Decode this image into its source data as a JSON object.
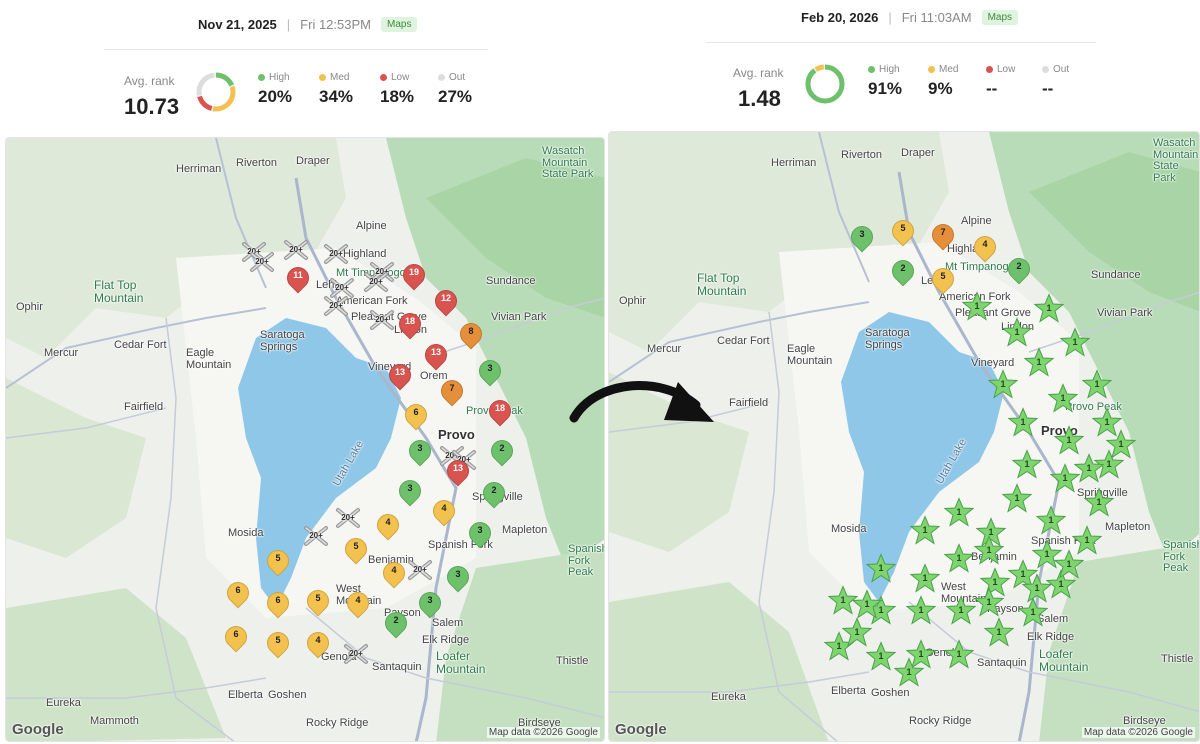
{
  "before": {
    "date": "Nov 21, 2025",
    "time": "Fri 12:53PM",
    "tag": "Maps",
    "avg_label": "Avg. rank",
    "avg_value": "10.73",
    "stats": [
      {
        "label": "High",
        "value": "20%",
        "color": "#6cc16a",
        "fraction": 0.2
      },
      {
        "label": "Med",
        "value": "34%",
        "color": "#f2c14e",
        "fraction": 0.34
      },
      {
        "label": "Low",
        "value": "18%",
        "color": "#d9534f",
        "fraction": 0.18
      },
      {
        "label": "Out",
        "value": "27%",
        "color": "#dddddd",
        "fraction": 0.27
      }
    ],
    "map_labels": {
      "riverton": "Riverton",
      "draper": "Draper",
      "herriman": "Herriman",
      "wasatch": "Wasatch Mountain State Park",
      "alpine": "Alpine",
      "highland": "Highland",
      "lehi": "Lehi",
      "mt_timp": "Mt Timpanogos",
      "sundance": "Sundance",
      "flat_top": "Flat Top Mountain",
      "ophir": "Ophir",
      "american_fork": "American Fork",
      "pleasant_grove": "Pleasant Grove",
      "lindon": "Lindon",
      "vivian_park": "Vivian Park",
      "saratoga": "Saratoga Springs",
      "cedar_fort": "Cedar Fort",
      "mercur": "Mercur",
      "eagle_mountain": "Eagle Mountain",
      "vineyard": "Vineyard",
      "orem": "Orem",
      "provo_peak": "Provo Peak",
      "fairfield": "Fairfield",
      "utah_lake": "Utah Lake",
      "provo": "Provo",
      "springville": "Springville",
      "mosida": "Mosida",
      "mapleton": "Mapleton",
      "spanish_fork": "Spanish Fork",
      "spanish_fork_peak": "Spanish Fork Peak",
      "benjamin": "Benjamin",
      "west_mountain": "West Mountain",
      "payson": "Payson",
      "salem": "Salem",
      "elk_ridge": "Elk Ridge",
      "genola": "Genola",
      "santaquin": "Santaquin",
      "loafer": "Loafer Mountain",
      "eureka": "Eureka",
      "elberta": "Elberta",
      "goshen": "Goshen",
      "mammoth": "Mammoth",
      "rocky_ridge": "Rocky Ridge",
      "birdseye": "Birdseye",
      "thistle": "Thistle"
    },
    "google": "Google",
    "attribution": "Map data ©2026 Google",
    "pins": [
      {
        "v": "11",
        "c": "red"
      },
      {
        "v": "19",
        "c": "red"
      },
      {
        "v": "12",
        "c": "red"
      },
      {
        "v": "18",
        "c": "red"
      },
      {
        "v": "8",
        "c": "orange"
      },
      {
        "v": "13",
        "c": "red"
      },
      {
        "v": "13",
        "c": "red"
      },
      {
        "v": "3",
        "c": "green"
      },
      {
        "v": "7",
        "c": "orange"
      },
      {
        "v": "6",
        "c": "yellow"
      },
      {
        "v": "18",
        "c": "red"
      },
      {
        "v": "3",
        "c": "green"
      },
      {
        "v": "2",
        "c": "green"
      },
      {
        "v": "13",
        "c": "red"
      },
      {
        "v": "3",
        "c": "green"
      },
      {
        "v": "2",
        "c": "green"
      },
      {
        "v": "4",
        "c": "yellow"
      },
      {
        "v": "4",
        "c": "yellow"
      },
      {
        "v": "3",
        "c": "green"
      },
      {
        "v": "5",
        "c": "yellow"
      },
      {
        "v": "5",
        "c": "yellow"
      },
      {
        "v": "4",
        "c": "yellow"
      },
      {
        "v": "3",
        "c": "green"
      },
      {
        "v": "6",
        "c": "yellow"
      },
      {
        "v": "6",
        "c": "yellow"
      },
      {
        "v": "5",
        "c": "yellow"
      },
      {
        "v": "4",
        "c": "yellow"
      },
      {
        "v": "3",
        "c": "green"
      },
      {
        "v": "2",
        "c": "green"
      },
      {
        "v": "6",
        "c": "yellow"
      },
      {
        "v": "5",
        "c": "yellow"
      },
      {
        "v": "4",
        "c": "yellow"
      }
    ],
    "grid_markers": [
      "20+",
      "20+",
      "20+",
      "20+",
      "20+",
      "20+",
      "20+",
      "20+",
      "20+",
      "20+",
      "20+",
      "20+",
      "20+",
      "20+",
      "20+"
    ]
  },
  "after": {
    "date": "Feb 20, 2026",
    "time": "Fri 11:03AM",
    "tag": "Maps",
    "avg_label": "Avg. rank",
    "avg_value": "1.48",
    "stats": [
      {
        "label": "High",
        "value": "91%",
        "color": "#6cc16a",
        "fraction": 0.91
      },
      {
        "label": "Med",
        "value": "9%",
        "color": "#f2c14e",
        "fraction": 0.09
      },
      {
        "label": "Low",
        "value": "--",
        "color": "#d9534f",
        "fraction": 0
      },
      {
        "label": "Out",
        "value": "--",
        "color": "#dddddd",
        "fraction": 0
      }
    ],
    "google": "Google",
    "attribution": "Map data ©2026 Google",
    "pins": [
      {
        "v": "3",
        "c": "green"
      },
      {
        "v": "5",
        "c": "yellow"
      },
      {
        "v": "7",
        "c": "orange"
      },
      {
        "v": "4",
        "c": "yellow"
      },
      {
        "v": "2",
        "c": "green"
      },
      {
        "v": "5",
        "c": "yellow"
      },
      {
        "v": "2",
        "c": "green"
      }
    ],
    "stars": [
      "1",
      "1",
      "1",
      "1",
      "1",
      "1",
      "1",
      "1",
      "1",
      "1",
      "1",
      "1",
      "1",
      "1",
      "1",
      "1",
      "1",
      "1",
      "1",
      "1",
      "1",
      "1",
      "1",
      "1",
      "1",
      "1",
      "1",
      "1",
      "1",
      "1",
      "1",
      "1",
      "1",
      "1",
      "1",
      "1",
      "1",
      "1",
      "1",
      "1",
      "1",
      "1",
      "1",
      "1",
      "1",
      "1",
      "1"
    ]
  }
}
